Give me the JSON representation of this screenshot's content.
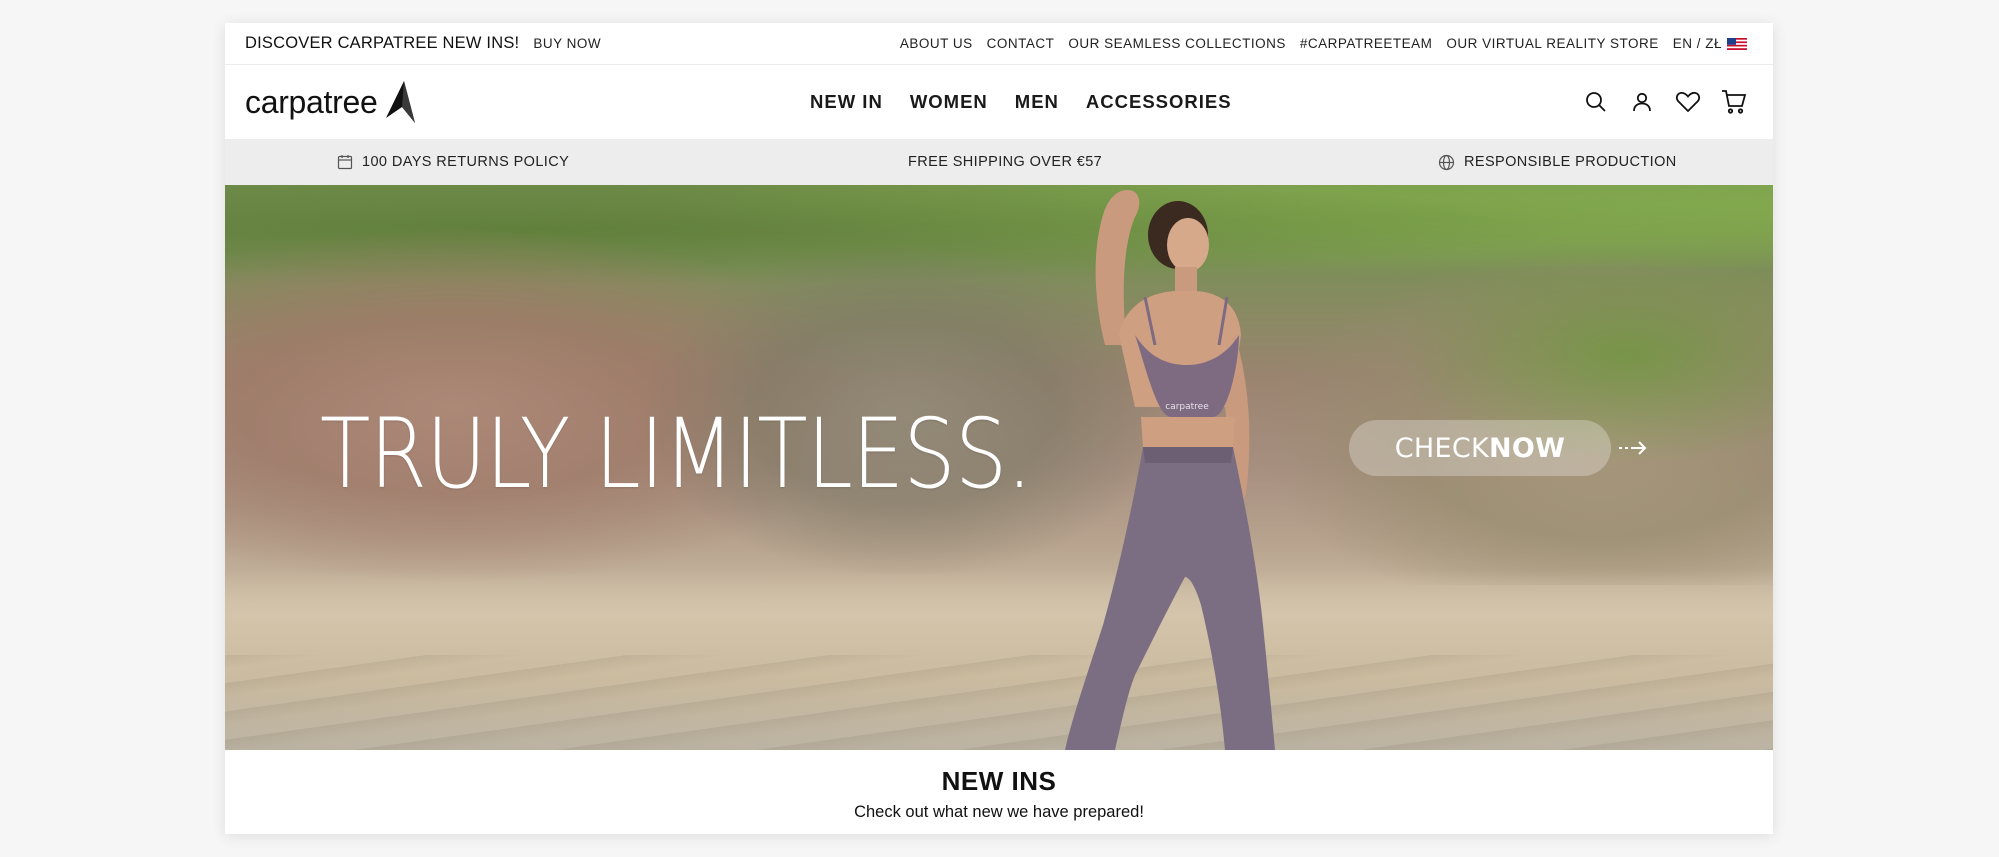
{
  "topbar": {
    "promo_text": "DISCOVER CARPATREE NEW INS!",
    "promo_link": "BUY NOW",
    "links": [
      "ABOUT US",
      "CONTACT",
      "OUR SEAMLESS COLLECTIONS",
      "#CARPATREETEAM",
      "OUR VIRTUAL REALITY STORE"
    ],
    "language": "EN / ZŁ",
    "flag_icon": "us-flag-icon"
  },
  "header": {
    "logo_text": "carpatree",
    "nav": [
      "NEW IN",
      "WOMEN",
      "MEN",
      "ACCESSORIES"
    ],
    "icons": [
      "search-icon",
      "user-icon",
      "heart-icon",
      "cart-icon"
    ]
  },
  "benefits": {
    "returns": "100 DAYS RETURNS POLICY",
    "shipping": "FREE SHIPPING OVER €57",
    "production": "RESPONSIBLE PRODUCTION"
  },
  "hero": {
    "title": "TRULY LIMITLESS.",
    "cta_check": "CHECK ",
    "cta_now": "NOW",
    "shirt_brand": "carpatree"
  },
  "new_ins": {
    "title": "NEW INS",
    "subtitle": "Check out what new we have prepared!"
  },
  "colors": {
    "page_bg": "#f6f6f6",
    "strip_bg": "#ededed",
    "text": "#1c1c1c",
    "accent": "#ffffff"
  }
}
